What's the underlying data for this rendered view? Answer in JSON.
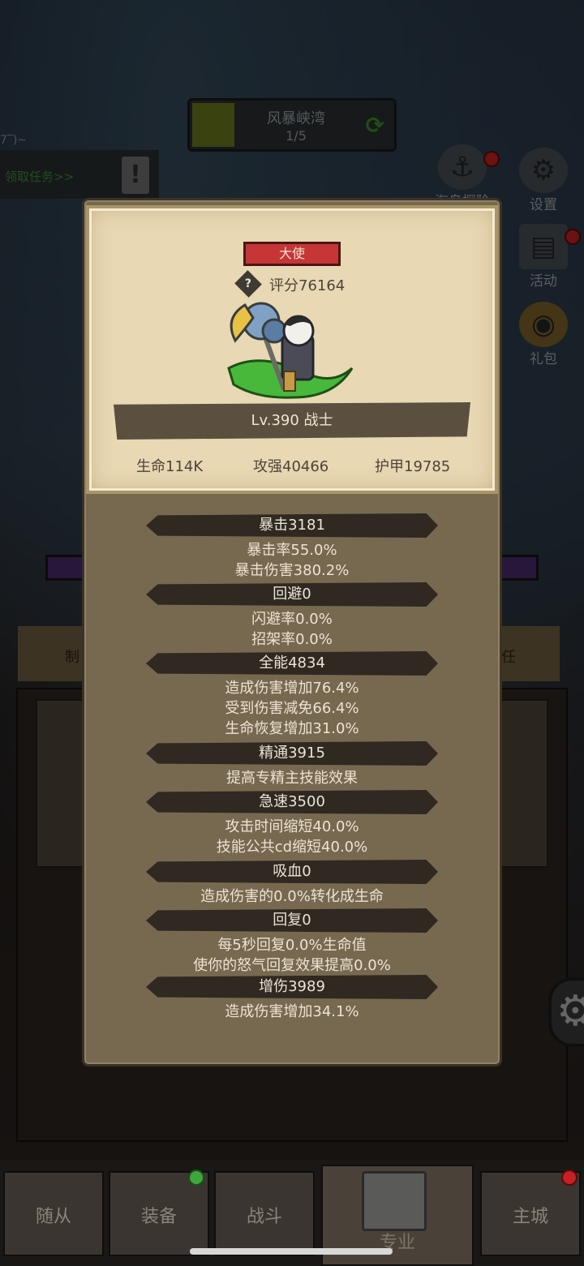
{
  "background": {
    "map": {
      "name": "风暴峡湾",
      "stage": "1/5"
    },
    "left_top_text": "7‾)~",
    "task_link": "领取任务>>",
    "alert_icon": "!",
    "side_buttons": [
      {
        "label": "海岛探险",
        "icon": "anchor-icon",
        "glyph": "⚓"
      },
      {
        "label": "设置",
        "icon": "gear-icon",
        "glyph": "⚙"
      },
      {
        "label": "活动",
        "icon": "scroll-icon",
        "glyph": "▤"
      },
      {
        "label": "礼包",
        "icon": "coin-icon",
        "glyph": "◉"
      }
    ],
    "tabs_left": "制",
    "tabs_right": "任",
    "gear_glyph": "⚙"
  },
  "nav": {
    "items": [
      {
        "label": "随从"
      },
      {
        "label": "装备"
      },
      {
        "label": "战斗"
      },
      {
        "label": "专业"
      },
      {
        "label": "主城"
      }
    ]
  },
  "profile": {
    "title": "大使",
    "help_glyph": "?",
    "score": "评分76164",
    "level_class": "Lv.390 战士",
    "hp": "生命114K",
    "attack": "攻强40466",
    "armor": "护甲19785"
  },
  "stats": [
    {
      "header": "暴击3181",
      "lines": [
        "暴击率55.0%",
        "暴击伤害380.2%"
      ]
    },
    {
      "header": "回避0",
      "lines": [
        "闪避率0.0%",
        "招架率0.0%"
      ]
    },
    {
      "header": "全能4834",
      "lines": [
        "造成伤害增加76.4%",
        "受到伤害减免66.4%",
        "生命恢复增加31.0%"
      ]
    },
    {
      "header": "精通3915",
      "lines": [
        "提高专精主技能效果"
      ]
    },
    {
      "header": "急速3500",
      "lines": [
        "攻击时间缩短40.0%",
        "技能公共cd缩短40.0%"
      ]
    },
    {
      "header": "吸血0",
      "lines": [
        "造成伤害的0.0%转化成生命"
      ]
    },
    {
      "header": "回复0",
      "lines": [
        "每5秒回复0.0%生命值",
        "使你的怒气回复效果提高0.0%"
      ]
    },
    {
      "header": "增伤3989",
      "lines": [
        "造成伤害增加34.1%"
      ]
    }
  ],
  "colors": {
    "panel": "#776850",
    "card": "#e8d8b3",
    "title_badge": "#c63636",
    "section_header": "#2f2922",
    "task_green": "#3d8a34",
    "badge_red": "#c42222"
  }
}
